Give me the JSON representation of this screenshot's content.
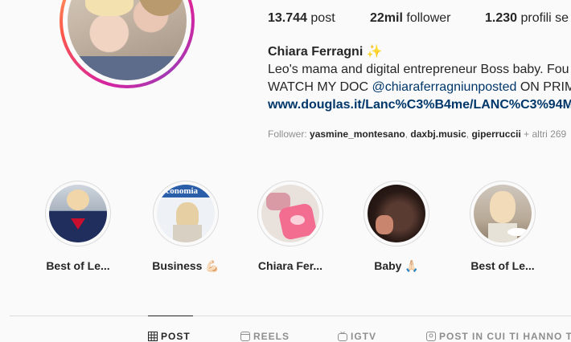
{
  "profile": {
    "stats": {
      "posts_count": "13.744",
      "posts_label": "post",
      "followers_count": "22mil",
      "followers_label": "follower",
      "following_count": "1.230",
      "following_label": "profili se"
    },
    "name": "Chiara Ferragni ✨",
    "bio_line1": "Leo's mama and digital entrepreneur Boss baby. Fou",
    "bio_line2_prefix": "WATCH MY DOC ",
    "bio_line2_tag": "@chiaraferragniunposted",
    "bio_line2_suffix": " ON PRIM",
    "link": "www.douglas.it/Lanc%C3%B4me/LANC%C3%94M",
    "followers_prefix": "Follower: ",
    "followers_names": [
      "yasmine_montesano",
      "daxbj.music",
      "giperruccii"
    ],
    "followers_more": " + altri 269"
  },
  "highlights": [
    {
      "label": "Best of Le..."
    },
    {
      "label": "Business 💪🏻"
    },
    {
      "label": "Chiara Fer..."
    },
    {
      "label": "Baby 🙏🏻"
    },
    {
      "label": "Best of Le..."
    }
  ],
  "tabs": [
    {
      "label": "POST",
      "icon": "grid-icon",
      "active": true
    },
    {
      "label": "REELS",
      "icon": "reels-icon"
    },
    {
      "label": "IGTV",
      "icon": "igtv-icon"
    },
    {
      "label": "POST IN CUI TI HANNO T",
      "icon": "tagged-icon"
    }
  ]
}
